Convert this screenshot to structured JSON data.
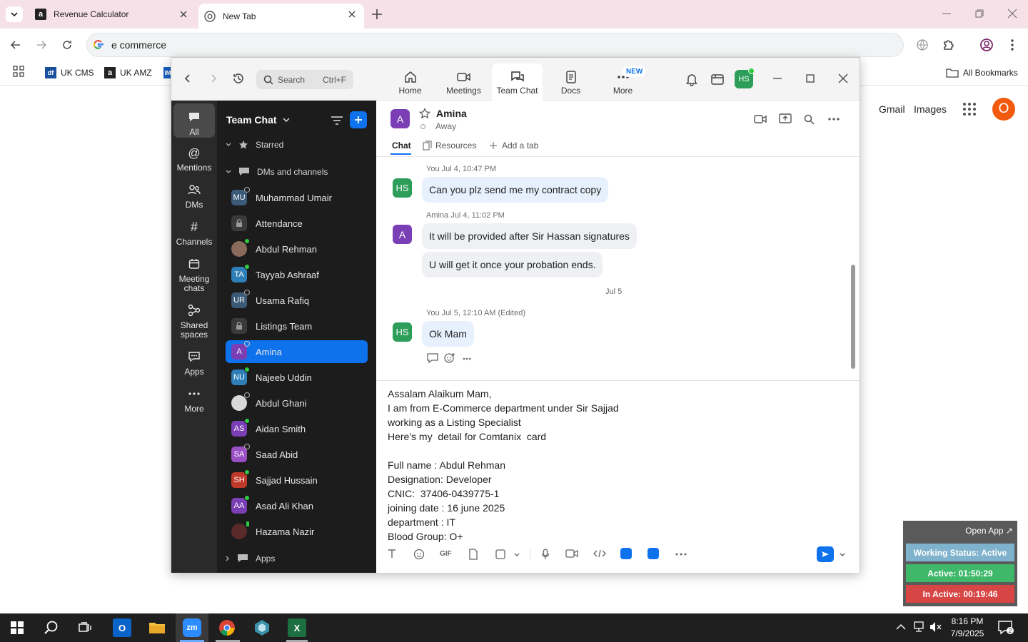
{
  "browser": {
    "tabs": [
      {
        "title": "Revenue Calculator",
        "icon": "amazon-icon"
      },
      {
        "title": "New Tab",
        "icon": "chrome-icon"
      }
    ],
    "omnibox_value": "e commerce",
    "bookmarks": [
      {
        "label": "UK CMS",
        "icon": "df"
      },
      {
        "label": "UK AMZ",
        "icon": "a"
      },
      {
        "label": "IM",
        "icon": "IM"
      }
    ],
    "all_bookmarks": "All Bookmarks"
  },
  "google": {
    "gmail": "Gmail",
    "images": "Images",
    "avatar_letter": "O"
  },
  "zoom": {
    "search_placeholder": "Search",
    "search_shortcut": "Ctrl+F",
    "nav": [
      {
        "label": "Home",
        "icon": "home-icon"
      },
      {
        "label": "Meetings",
        "icon": "video-icon"
      },
      {
        "label": "Team Chat",
        "icon": "chat-icon"
      },
      {
        "label": "Docs",
        "icon": "docs-icon"
      },
      {
        "label": "More",
        "icon": "more-icon",
        "badge": "NEW"
      }
    ],
    "user_initials": "HS",
    "rail": [
      {
        "label": "All"
      },
      {
        "label": "Mentions"
      },
      {
        "label": "DMs"
      },
      {
        "label": "Channels"
      },
      {
        "label": "Meeting chats"
      },
      {
        "label": "Shared spaces"
      },
      {
        "label": "Apps"
      },
      {
        "label": "More"
      }
    ],
    "sidebar": {
      "title": "Team Chat",
      "starred": "Starred",
      "dms_and_channels": "DMs and channels",
      "apps": "Apps",
      "contacts": [
        {
          "name": "Muhammad Umair",
          "initials": "MU",
          "color": "#3a5a78",
          "status": "off"
        },
        {
          "name": "Attendance",
          "initials": "",
          "color": "#3a3a3a",
          "status": "lock"
        },
        {
          "name": "Abdul Rehman",
          "initials": "",
          "color": "#8a6a5a",
          "status": "on"
        },
        {
          "name": "Tayyab Ashraaf",
          "initials": "TA",
          "color": "#2e7fb8",
          "status": "on"
        },
        {
          "name": "Usama Rafiq",
          "initials": "UR",
          "color": "#3a5a78",
          "status": "off"
        },
        {
          "name": "Listings Team",
          "initials": "",
          "color": "#3a3a3a",
          "status": "lock"
        },
        {
          "name": "Amina",
          "initials": "A",
          "color": "#7b3fb5",
          "status": "off"
        },
        {
          "name": "Najeeb Uddin",
          "initials": "NU",
          "color": "#2e7fb8",
          "status": "on"
        },
        {
          "name": "Abdul Ghani",
          "initials": "",
          "color": "#d8d8d8",
          "status": "off"
        },
        {
          "name": "Aidan Smith",
          "initials": "AS",
          "color": "#7b3fb5",
          "status": "on"
        },
        {
          "name": "Saad Abid",
          "initials": "SA",
          "color": "#9b4fc5",
          "status": "off"
        },
        {
          "name": "Sajjad Hussain",
          "initials": "SH",
          "color": "#c0392b",
          "status": "on"
        },
        {
          "name": "Asad Ali Khan",
          "initials": "AA",
          "color": "#7b3fb5",
          "status": "on"
        },
        {
          "name": "Hazama Nazir",
          "initials": "",
          "color": "#5a2a2a",
          "status": "mobile"
        }
      ]
    },
    "chat": {
      "contact_name": "Amina",
      "contact_initial": "A",
      "contact_status": "Away",
      "tabs": [
        "Chat",
        "Resources",
        "Add a tab"
      ],
      "messages": [
        {
          "meta": "You Jul 4, 10:47 PM",
          "avatar": "HS",
          "text": "Can you plz send me my contract copy"
        },
        {
          "meta": "Amina Jul 4, 11:02 PM",
          "avatar": "A",
          "text": "It will be provided after Sir Hassan signatures"
        },
        {
          "text": "U will get it once your probation ends."
        },
        {
          "date_divider": "Jul 5"
        },
        {
          "meta": "You Jul 5, 12:10 AM (Edited)",
          "avatar": "HS",
          "text": "Ok Mam"
        }
      ],
      "composer_lines": [
        "Assalam Alaikum Mam,",
        "I am from E-Commerce department under Sir Sajjad",
        "working as a Listing Specialist",
        "Here's my  detail for Comtanix  card",
        "",
        "Full name : Abdul Rehman",
        "Designation: Developer",
        "CNIC:  37406-0439775-1",
        "joining date : 16 june 2025",
        "department : IT",
        "Blood Group: O+"
      ],
      "gif_label": "GIF"
    }
  },
  "widget": {
    "open_app": "Open App ↗",
    "working_status": "Working Status: Active",
    "active": "Active: 01:50:29",
    "inactive": "In Active: 00:19:46"
  },
  "taskbar": {
    "time": "8:16 PM",
    "date": "7/9/2025"
  },
  "colors": {
    "zoom_blue": "#0e72ed",
    "hs_green": "#2d9e5a",
    "amina_purple": "#7b3fb5"
  }
}
